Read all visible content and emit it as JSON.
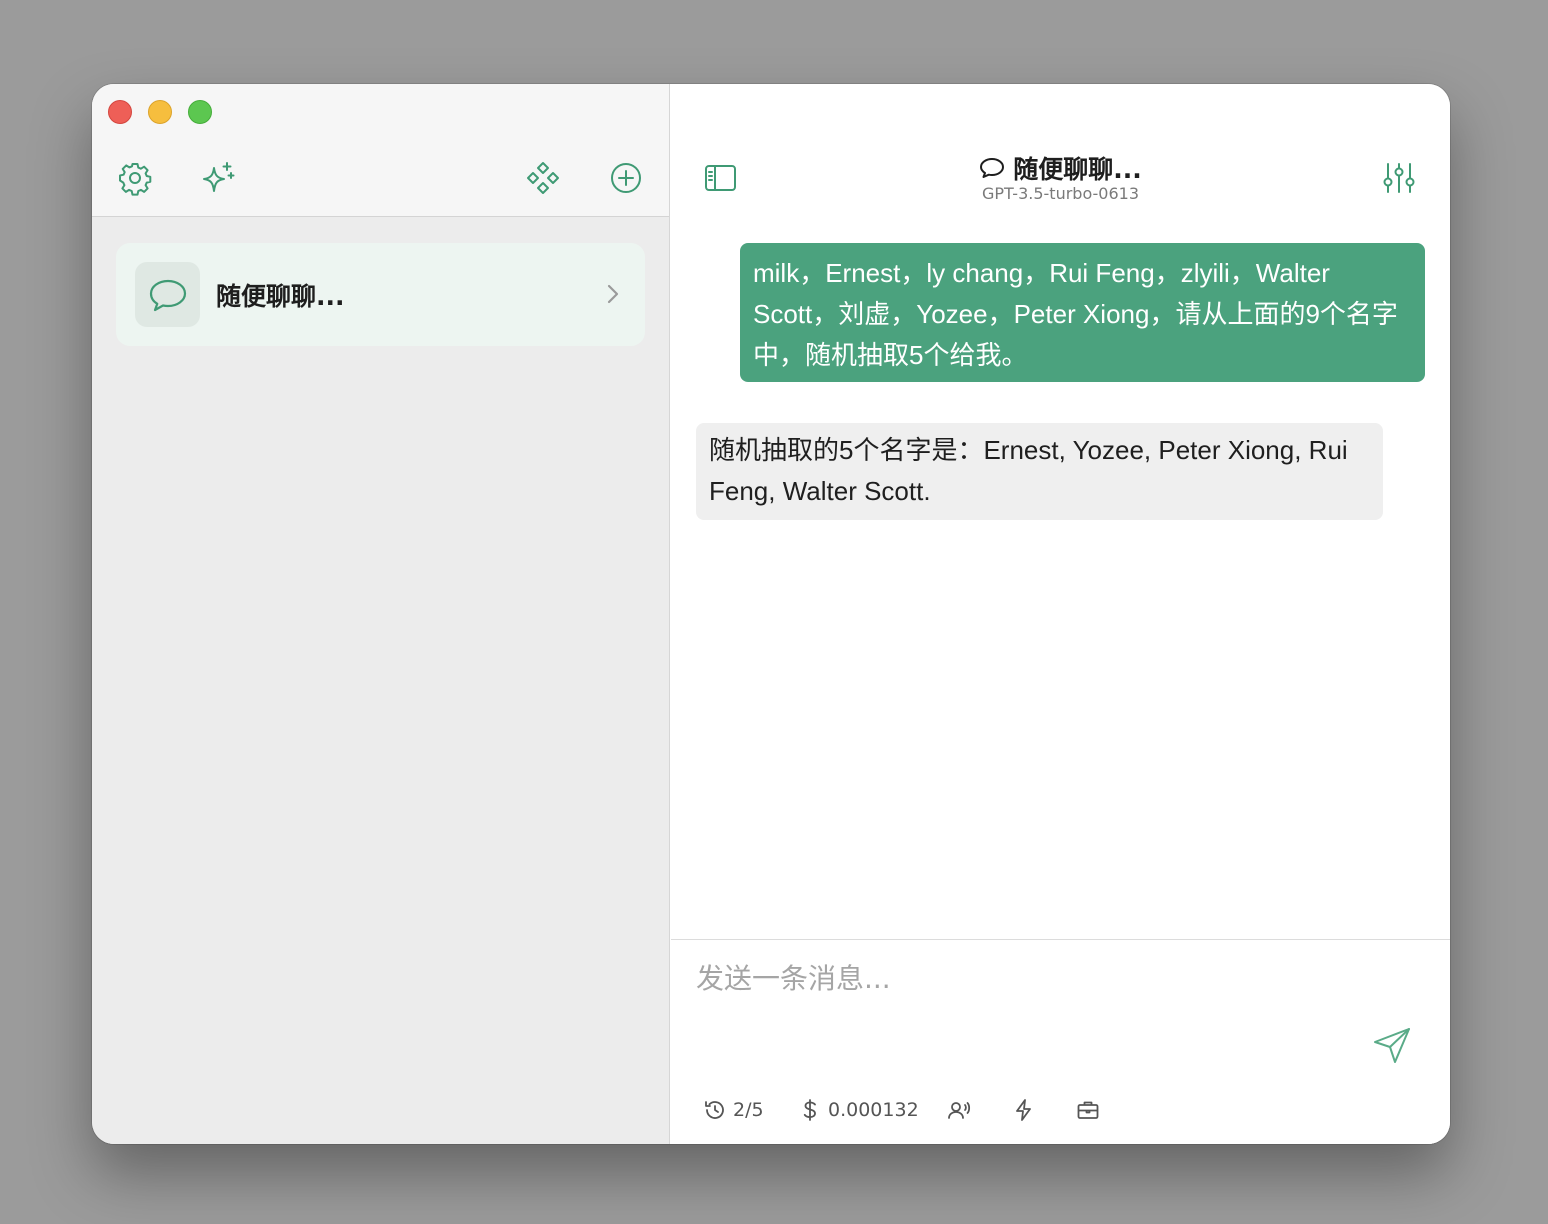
{
  "sidebar": {
    "toolbar": {
      "settings_icon": "gear-icon",
      "prompts_icon": "sparkles-icon",
      "plugins_icon": "diamond-grid-icon",
      "new_chat_icon": "plus-circle-icon"
    },
    "conversations": [
      {
        "title": "随便聊聊...",
        "icon": "chat-bubble-icon"
      }
    ]
  },
  "header": {
    "title": "随便聊聊...",
    "model": "GPT-3.5-turbo-0613"
  },
  "messages": [
    {
      "role": "user",
      "text": "milk，Ernest，ly chang，Rui Feng，zlyili，Walter Scott，刘虚，Yozee，Peter Xiong，请从上面的9个名字中，随机抽取5个给我。"
    },
    {
      "role": "assistant",
      "text": "随机抽取的5个名字是：Ernest, Yozee, Peter Xiong, Rui Feng, Walter Scott."
    }
  ],
  "composer": {
    "placeholder": "发送一条消息...",
    "stats": {
      "history": "2/5",
      "cost": "0.000132"
    }
  },
  "colors": {
    "accent": "#4ba27e",
    "user_bubble": "#4ba27e",
    "assistant_bubble": "#efefef"
  }
}
